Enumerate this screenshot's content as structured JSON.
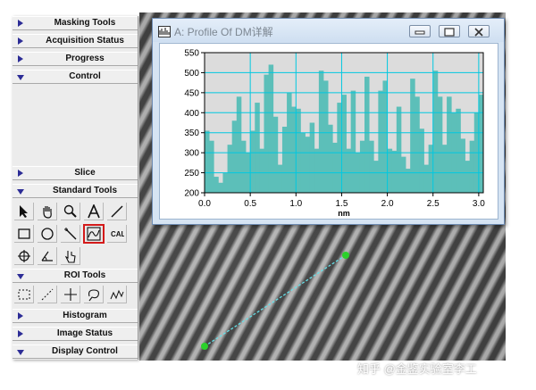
{
  "palette": {
    "bars": [
      {
        "label": "Masking Tools",
        "expanded": false
      },
      {
        "label": "Acquisition Status",
        "expanded": false
      },
      {
        "label": "Progress",
        "expanded": false
      },
      {
        "label": "Control",
        "expanded": true
      },
      {
        "label": "Slice",
        "expanded": false
      },
      {
        "label": "Standard Tools",
        "expanded": true
      },
      {
        "label": "ROI Tools",
        "expanded": true
      },
      {
        "label": "Histogram",
        "expanded": false
      },
      {
        "label": "Image Status",
        "expanded": false
      },
      {
        "label": "Display Control",
        "expanded": true
      }
    ],
    "standard_tools": [
      "arrow-select-icon",
      "hand-pan-icon",
      "magnifier-icon",
      "text-tool-icon",
      "line-tool-icon",
      "rectangle-tool-icon",
      "oval-tool-icon",
      "wand-tool-icon",
      "line-profile-tool-icon",
      "calibration-tool-icon",
      "crosshair-tool-icon",
      "angle-tool-icon",
      "hand-select-icon"
    ],
    "selected_tool": "line-profile-tool-icon",
    "roi_tools": [
      "rect-roi-icon",
      "line-roi-icon",
      "point-roi-icon",
      "lasso-roi-icon",
      "curve-roi-icon"
    ]
  },
  "profile_window": {
    "title": "A: Profile Of DM详解"
  },
  "colors": {
    "bar_fill": "#5cbfb9",
    "grid": "#00c8e0",
    "selection": "#d41a1a",
    "line_roi": "#66e0e8",
    "roi_endpoint": "#2bd12b"
  },
  "chart_data": {
    "type": "bar",
    "xlabel": "nm",
    "ylabel": "",
    "xlim": [
      0,
      3.05
    ],
    "ylim": [
      200,
      550
    ],
    "xticks": [
      "0.0",
      "0.5",
      "1.0",
      "1.5",
      "2.0",
      "2.5",
      "3.0"
    ],
    "yticks": [
      "200",
      "250",
      "300",
      "350",
      "400",
      "450",
      "500",
      "550"
    ],
    "bin_width": 0.05,
    "x": [
      0.0,
      0.05,
      0.1,
      0.15,
      0.2,
      0.25,
      0.3,
      0.35,
      0.4,
      0.45,
      0.5,
      0.55,
      0.6,
      0.65,
      0.7,
      0.75,
      0.8,
      0.85,
      0.9,
      0.95,
      1.0,
      1.05,
      1.1,
      1.15,
      1.2,
      1.25,
      1.3,
      1.35,
      1.4,
      1.45,
      1.5,
      1.55,
      1.6,
      1.65,
      1.7,
      1.75,
      1.8,
      1.85,
      1.9,
      1.95,
      2.0,
      2.05,
      2.1,
      2.15,
      2.2,
      2.25,
      2.3,
      2.35,
      2.4,
      2.45,
      2.5,
      2.55,
      2.6,
      2.65,
      2.7,
      2.75,
      2.8,
      2.85,
      2.9,
      2.95,
      3.0
    ],
    "values": [
      355,
      330,
      240,
      225,
      250,
      320,
      380,
      440,
      330,
      300,
      355,
      425,
      310,
      495,
      520,
      390,
      270,
      365,
      450,
      415,
      410,
      350,
      340,
      375,
      310,
      505,
      480,
      370,
      325,
      425,
      445,
      310,
      455,
      300,
      330,
      490,
      330,
      280,
      455,
      480,
      310,
      305,
      415,
      290,
      260,
      485,
      440,
      360,
      270,
      320,
      505,
      440,
      320,
      440,
      400,
      410,
      335,
      280,
      330,
      400,
      445
    ]
  }
}
